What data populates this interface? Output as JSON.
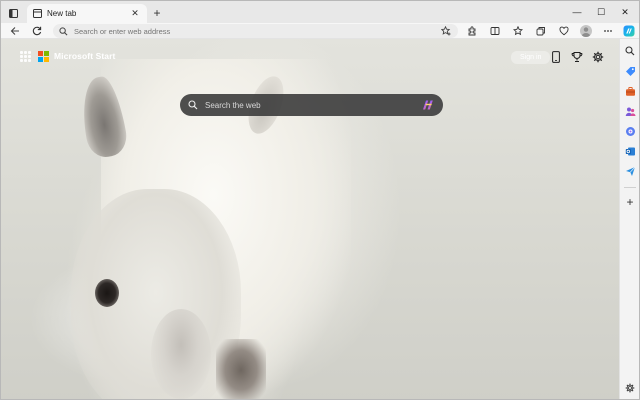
{
  "browser": {
    "tab": {
      "title": "New tab",
      "close_symbol": "✕"
    },
    "new_tab_symbol": "+",
    "window": {
      "minimize": "—",
      "maximize": "☐",
      "close": "✕"
    },
    "address_bar": {
      "placeholder": "Search or enter web address",
      "value": ""
    }
  },
  "newtab_page": {
    "brand": "Microsoft Start",
    "sign_in": "Sign in",
    "search": {
      "placeholder": "Search the web"
    }
  },
  "colors": {
    "ms_red": "#f25022",
    "ms_green": "#7fba00",
    "ms_blue": "#00a4ef",
    "ms_yellow": "#ffb900",
    "copilot": "#2b7fff",
    "search_bg": "#3c3c3c"
  },
  "sidebar": {
    "items": [
      {
        "icon": "search-icon"
      },
      {
        "icon": "tag-icon"
      },
      {
        "icon": "briefcase-icon"
      },
      {
        "icon": "people-icon"
      },
      {
        "icon": "copilot-icon"
      },
      {
        "icon": "outlook-icon"
      },
      {
        "icon": "send-icon"
      }
    ],
    "add_symbol": "+"
  }
}
